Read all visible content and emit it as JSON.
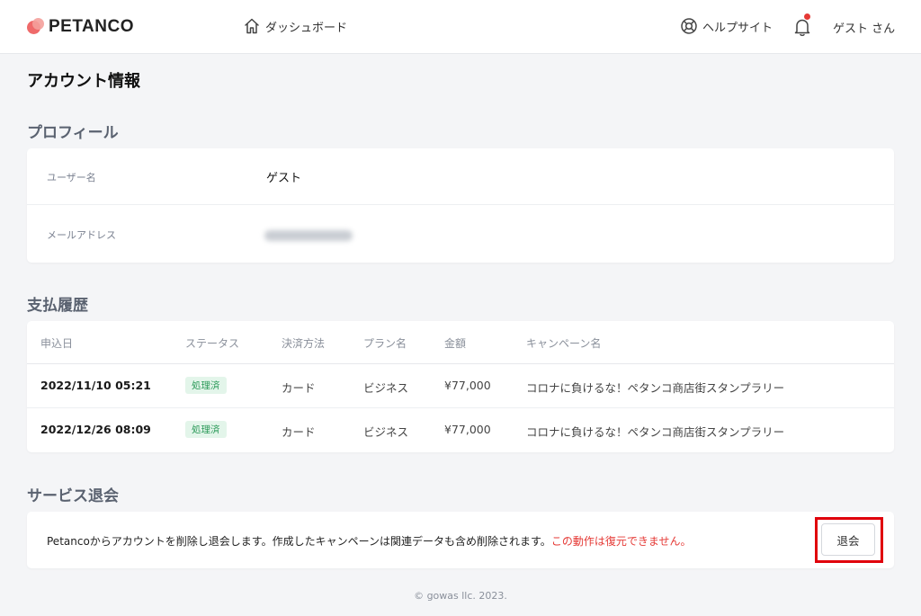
{
  "header": {
    "logo_text": "PETANCO",
    "logo_icon": "petanco-logo-circles",
    "nav_dashboard": "ダッシュボード",
    "help_site": "ヘルプサイト",
    "user_name": "ゲスト さん",
    "notification_dot_color": "#e53935"
  },
  "page": {
    "title": "アカウント情報"
  },
  "profile": {
    "section_title": "プロフィール",
    "username_label": "ユーザー名",
    "username_value": "ゲスト",
    "email_label": "メールアドレス"
  },
  "payments": {
    "section_title": "支払履歴",
    "columns": [
      "申込日",
      "ステータス",
      "決済方法",
      "プラン名",
      "金額",
      "キャンペーン名"
    ],
    "rows": [
      {
        "date": "2022/11/10 05:21",
        "status": "処理済",
        "method": "カード",
        "plan": "ビジネス",
        "amount": "¥77,000",
        "campaign": "コロナに負けるな！ペタンコ商店街スタンプラリー"
      },
      {
        "date": "2022/12/26 08:09",
        "status": "処理済",
        "method": "カード",
        "plan": "ビジネス",
        "amount": "¥77,000",
        "campaign": "コロナに負けるな！ペタンコ商店街スタンプラリー"
      }
    ]
  },
  "withdrawal": {
    "section_title": "サービス退会",
    "description": "Petancoからアカウントを削除し退会します。作成したキャンペーンは関連データも含め削除されます。",
    "warning": "この動作は復元できません。",
    "button_label": "退会",
    "highlight_color": "#e0000b"
  },
  "footer": {
    "copyright": "© gowas llc. 2023."
  }
}
